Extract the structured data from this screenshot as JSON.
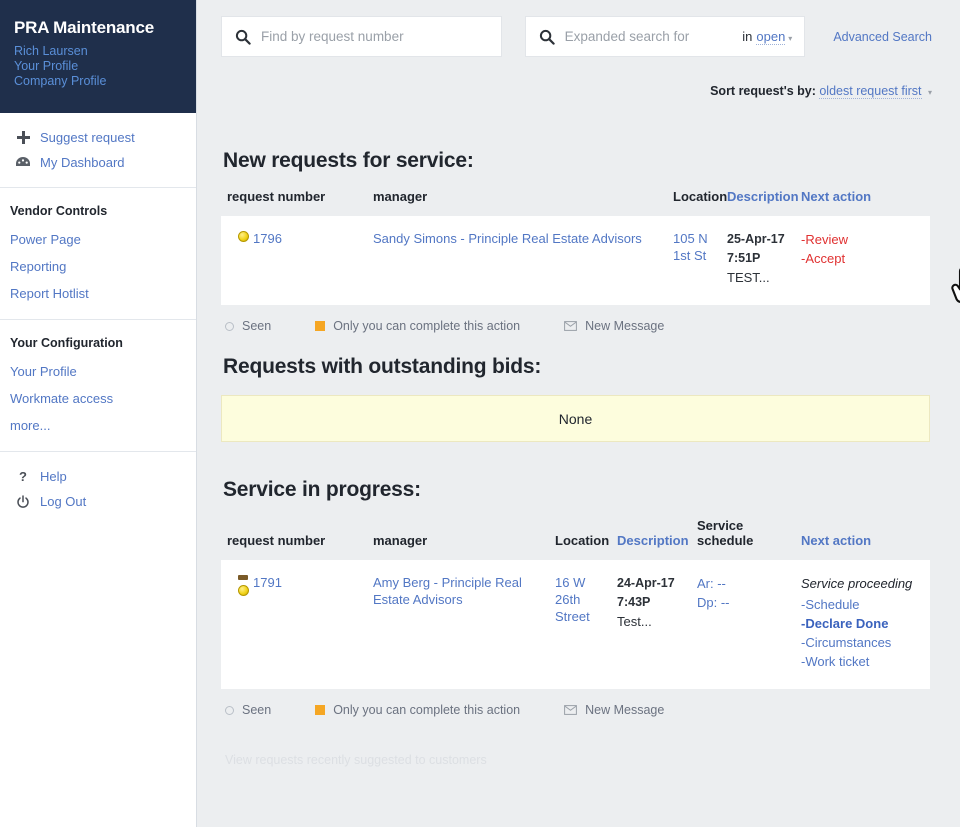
{
  "sidebar": {
    "brand": "PRA Maintenance",
    "user_links": [
      "Rich Laursen",
      "Your Profile",
      "Company Profile"
    ],
    "quick_actions": [
      {
        "label": "Suggest request",
        "icon": "plus-icon"
      },
      {
        "label": "My Dashboard",
        "icon": "dashboard-icon"
      }
    ],
    "vendor_controls": {
      "title": "Vendor Controls",
      "items": [
        "Power Page",
        "Reporting",
        "Report Hotlist"
      ]
    },
    "your_configuration": {
      "title": "Your Configuration",
      "items": [
        "Your Profile",
        "Workmate access",
        "more..."
      ]
    },
    "footer_actions": [
      {
        "label": "Help",
        "icon": "question-icon"
      },
      {
        "label": "Log Out",
        "icon": "power-icon"
      }
    ]
  },
  "topbar": {
    "search_number_placeholder": "Find by request number",
    "search_number_value": "",
    "expanded_search_placeholder": "Expanded search for",
    "expanded_search_value": "",
    "in_label": "in",
    "in_scope": "open",
    "advanced_search": "Advanced Search",
    "sort_label": "Sort request's by:",
    "sort_value": "oldest request first"
  },
  "sections": {
    "new_requests": {
      "title": "New requests for service:",
      "columns": [
        {
          "label": "request number",
          "link": false
        },
        {
          "label": "manager",
          "link": false
        },
        {
          "label": "Location",
          "link": false
        },
        {
          "label": "Description",
          "link": true
        },
        {
          "label": "Next action",
          "link": true
        }
      ],
      "rows": [
        {
          "request_number": "1796",
          "status_icons": [
            "yellow-dot"
          ],
          "manager": "Sandy Simons - Principle Real Estate Advisors",
          "location": "105 N 1st St",
          "description_date": "25-Apr-17",
          "description_time": "7:51P",
          "description_text": "TEST...",
          "actions": [
            {
              "label": "-Review",
              "style": "red"
            },
            {
              "label": "-Accept",
              "style": "red"
            }
          ]
        }
      ]
    },
    "outstanding_bids": {
      "title": "Requests with outstanding bids:",
      "empty_text": "None"
    },
    "service_in_progress": {
      "title": "Service in progress:",
      "columns": [
        {
          "label": "request number",
          "link": false
        },
        {
          "label": "manager",
          "link": false
        },
        {
          "label": "Location",
          "link": false
        },
        {
          "label": "Description",
          "link": true
        },
        {
          "label": "Service schedule",
          "link": false
        },
        {
          "label": "Next action",
          "link": true
        }
      ],
      "rows": [
        {
          "request_number": "1791",
          "status_icons": [
            "mini-badge",
            "yellow-dot"
          ],
          "manager": "Amy Berg - Principle Real Estate Advisors",
          "location": "16 W 26th Street",
          "description_date": "24-Apr-17",
          "description_time": "7:43P",
          "description_text": "Test...",
          "schedule_arrive": "Ar: --",
          "schedule_depart": "Dp: --",
          "status_text": "Service proceeding",
          "actions": [
            {
              "label": "-Schedule",
              "style": "blue"
            },
            {
              "label": "-Declare Done",
              "style": "blue-strong"
            },
            {
              "label": "-Circumstances",
              "style": "blue"
            },
            {
              "label": "-Work ticket",
              "style": "blue"
            }
          ]
        }
      ]
    }
  },
  "legend": {
    "seen": "Seen",
    "only_you": "Only you can complete this action",
    "new_message": "New Message"
  },
  "footer": {
    "view_recent": "View requests recently suggested to customers"
  },
  "colors": {
    "sidebar_header_bg": "#1f2f4b",
    "link_blue": "#5277c4",
    "action_red": "#e03131",
    "status_yellow": "#f2d41c",
    "legend_orange": "#f5a623",
    "empty_box_bg": "#fdfddd",
    "main_bg": "#eceef0"
  }
}
